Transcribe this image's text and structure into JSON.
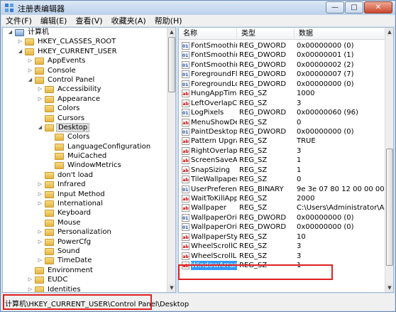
{
  "window": {
    "title": "注册表编辑器"
  },
  "menu": [
    "文件(F)",
    "编辑(E)",
    "查看(V)",
    "收藏夹(A)",
    "帮助(H)"
  ],
  "tree": [
    {
      "label": "计算机",
      "depth": 0,
      "exp": "down",
      "type": "pc"
    },
    {
      "label": "HKEY_CLASSES_ROOT",
      "depth": 1,
      "exp": "right"
    },
    {
      "label": "HKEY_CURRENT_USER",
      "depth": 1,
      "exp": "down"
    },
    {
      "label": "AppEvents",
      "depth": 2,
      "exp": "right"
    },
    {
      "label": "Console",
      "depth": 2,
      "exp": "right"
    },
    {
      "label": "Control Panel",
      "depth": 2,
      "exp": "down"
    },
    {
      "label": "Accessibility",
      "depth": 3,
      "exp": "right"
    },
    {
      "label": "Appearance",
      "depth": 3,
      "exp": "right"
    },
    {
      "label": "Colors",
      "depth": 3,
      "exp": ""
    },
    {
      "label": "Cursors",
      "depth": 3,
      "exp": ""
    },
    {
      "label": "Desktop",
      "depth": 3,
      "exp": "down",
      "selected": true
    },
    {
      "label": "Colors",
      "depth": 4,
      "exp": ""
    },
    {
      "label": "LanguageConfiguration",
      "depth": 4,
      "exp": ""
    },
    {
      "label": "MuiCached",
      "depth": 4,
      "exp": ""
    },
    {
      "label": "WindowMetrics",
      "depth": 4,
      "exp": ""
    },
    {
      "label": "don't load",
      "depth": 3,
      "exp": ""
    },
    {
      "label": "Infrared",
      "depth": 3,
      "exp": "right"
    },
    {
      "label": "Input Method",
      "depth": 3,
      "exp": "right"
    },
    {
      "label": "International",
      "depth": 3,
      "exp": "right"
    },
    {
      "label": "Keyboard",
      "depth": 3,
      "exp": ""
    },
    {
      "label": "Mouse",
      "depth": 3,
      "exp": ""
    },
    {
      "label": "Personalization",
      "depth": 3,
      "exp": "right"
    },
    {
      "label": "PowerCfg",
      "depth": 3,
      "exp": "right"
    },
    {
      "label": "Sound",
      "depth": 3,
      "exp": ""
    },
    {
      "label": "TimeDate",
      "depth": 3,
      "exp": "right"
    },
    {
      "label": "Environment",
      "depth": 2,
      "exp": ""
    },
    {
      "label": "EUDC",
      "depth": 2,
      "exp": "right"
    },
    {
      "label": "Identities",
      "depth": 2,
      "exp": "right"
    }
  ],
  "columns": {
    "name": "名称",
    "type": "类型",
    "data": "数据"
  },
  "values": [
    {
      "icon": "bin",
      "name": "FontSmoothin...",
      "type": "REG_DWORD",
      "data": "0x00000000 (0)"
    },
    {
      "icon": "bin",
      "name": "FontSmoothin...",
      "type": "REG_DWORD",
      "data": "0x00000001 (1)"
    },
    {
      "icon": "bin",
      "name": "FontSmoothin...",
      "type": "REG_DWORD",
      "data": "0x00000002 (2)"
    },
    {
      "icon": "bin",
      "name": "ForegroundFla...",
      "type": "REG_DWORD",
      "data": "0x00000007 (7)"
    },
    {
      "icon": "bin",
      "name": "ForegroundLo...",
      "type": "REG_DWORD",
      "data": "0x00000000 (0)"
    },
    {
      "icon": "sz",
      "name": "HungAppTime...",
      "type": "REG_SZ",
      "data": "1000"
    },
    {
      "icon": "sz",
      "name": "LeftOverlapCh...",
      "type": "REG_SZ",
      "data": "3"
    },
    {
      "icon": "bin",
      "name": "LogPixels",
      "type": "REG_DWORD",
      "data": "0x00000060 (96)"
    },
    {
      "icon": "sz",
      "name": "MenuShowDelay",
      "type": "REG_SZ",
      "data": "0"
    },
    {
      "icon": "bin",
      "name": "PaintDesktopV...",
      "type": "REG_DWORD",
      "data": "0x00000000 (0)"
    },
    {
      "icon": "sz",
      "name": "Pattern Upgra...",
      "type": "REG_SZ",
      "data": "TRUE"
    },
    {
      "icon": "sz",
      "name": "RightOverlapC...",
      "type": "REG_SZ",
      "data": "3"
    },
    {
      "icon": "sz",
      "name": "ScreenSaveActi...",
      "type": "REG_SZ",
      "data": "1"
    },
    {
      "icon": "sz",
      "name": "SnapSizing",
      "type": "REG_SZ",
      "data": "1"
    },
    {
      "icon": "sz",
      "name": "TileWallpaper",
      "type": "REG_SZ",
      "data": "0"
    },
    {
      "icon": "bin",
      "name": "UserPreferenc...",
      "type": "REG_BINARY",
      "data": "9e 3e 07 80 12 00 00 00"
    },
    {
      "icon": "sz",
      "name": "WaitToKillApp...",
      "type": "REG_SZ",
      "data": "2000"
    },
    {
      "icon": "sz",
      "name": "Wallpaper",
      "type": "REG_SZ",
      "data": "C:\\Users\\Administrator\\AppData"
    },
    {
      "icon": "bin",
      "name": "WallpaperOrig...",
      "type": "REG_DWORD",
      "data": "0x00000000 (0)"
    },
    {
      "icon": "bin",
      "name": "WallpaperOrig...",
      "type": "REG_DWORD",
      "data": "0x00000000 (0)"
    },
    {
      "icon": "sz",
      "name": "WallpaperStyle",
      "type": "REG_SZ",
      "data": "10"
    },
    {
      "icon": "sz",
      "name": "WheelScrollCh...",
      "type": "REG_SZ",
      "data": "3"
    },
    {
      "icon": "sz",
      "name": "WheelScrollLin...",
      "type": "REG_SZ",
      "data": "3"
    },
    {
      "icon": "sz",
      "name": "WindowArrang...",
      "type": "REG_SZ",
      "data": "1",
      "selected": true
    }
  ],
  "status": "计算机\\HKEY_CURRENT_USER\\Control Panel\\Desktop",
  "colors": {
    "highlight": "#e02020",
    "selection": "#3399ff"
  }
}
